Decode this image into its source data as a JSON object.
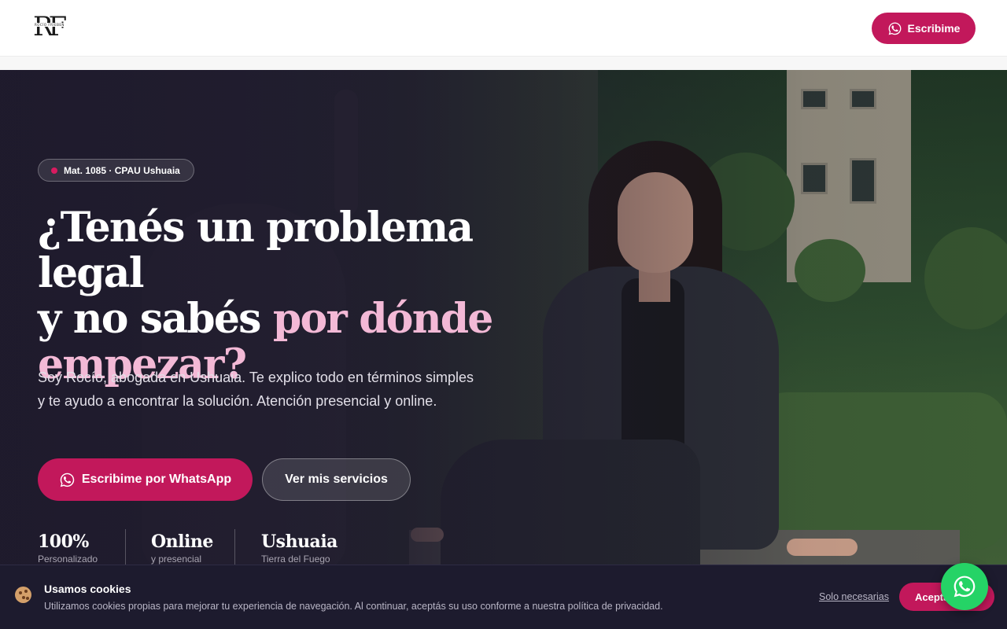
{
  "header": {
    "logo_letters": "RF",
    "logo_subtitle": "ROCÍO FRIEBEN",
    "cta_label": "Escribime",
    "cta_icon": "whatsapp-icon"
  },
  "hero": {
    "badge": "Mat. 1085 · CPAU Ushuaia",
    "title_line1": "¿Tenés un problema legal",
    "title_line2_a": "y no sabés ",
    "title_line2_b": "por dónde",
    "title_line3": "empezar?",
    "lead": "Soy Rocío, abogada en Ushuaia. Te explico todo en términos simples y te ayudo a encontrar la solución. Atención presencial y online.",
    "cta_primary": "Escribime por WhatsApp",
    "cta_secondary": "Ver mis servicios",
    "stats": [
      {
        "value": "100%",
        "label": "Personalizado"
      },
      {
        "value": "Online",
        "label": "y presencial"
      },
      {
        "value": "Ushuaia",
        "label": "Tierra del Fuego"
      }
    ]
  },
  "cookie_banner": {
    "icon": "cookie-icon",
    "title": "Usamos cookies",
    "text": "Utilizamos cookies propias para mejorar tu experiencia de navegación. Al continuar, aceptás su uso conforme a nuestra política de privacidad.",
    "necessary_label": "Solo necesarias",
    "accept_label": "Aceptar"
  },
  "floating_button": {
    "icon": "whatsapp-icon"
  },
  "colors": {
    "accent": "#c2185b",
    "highlight": "#f3b9d6",
    "whatsapp": "#25d366",
    "dark_bg": "#1d1b2e"
  }
}
